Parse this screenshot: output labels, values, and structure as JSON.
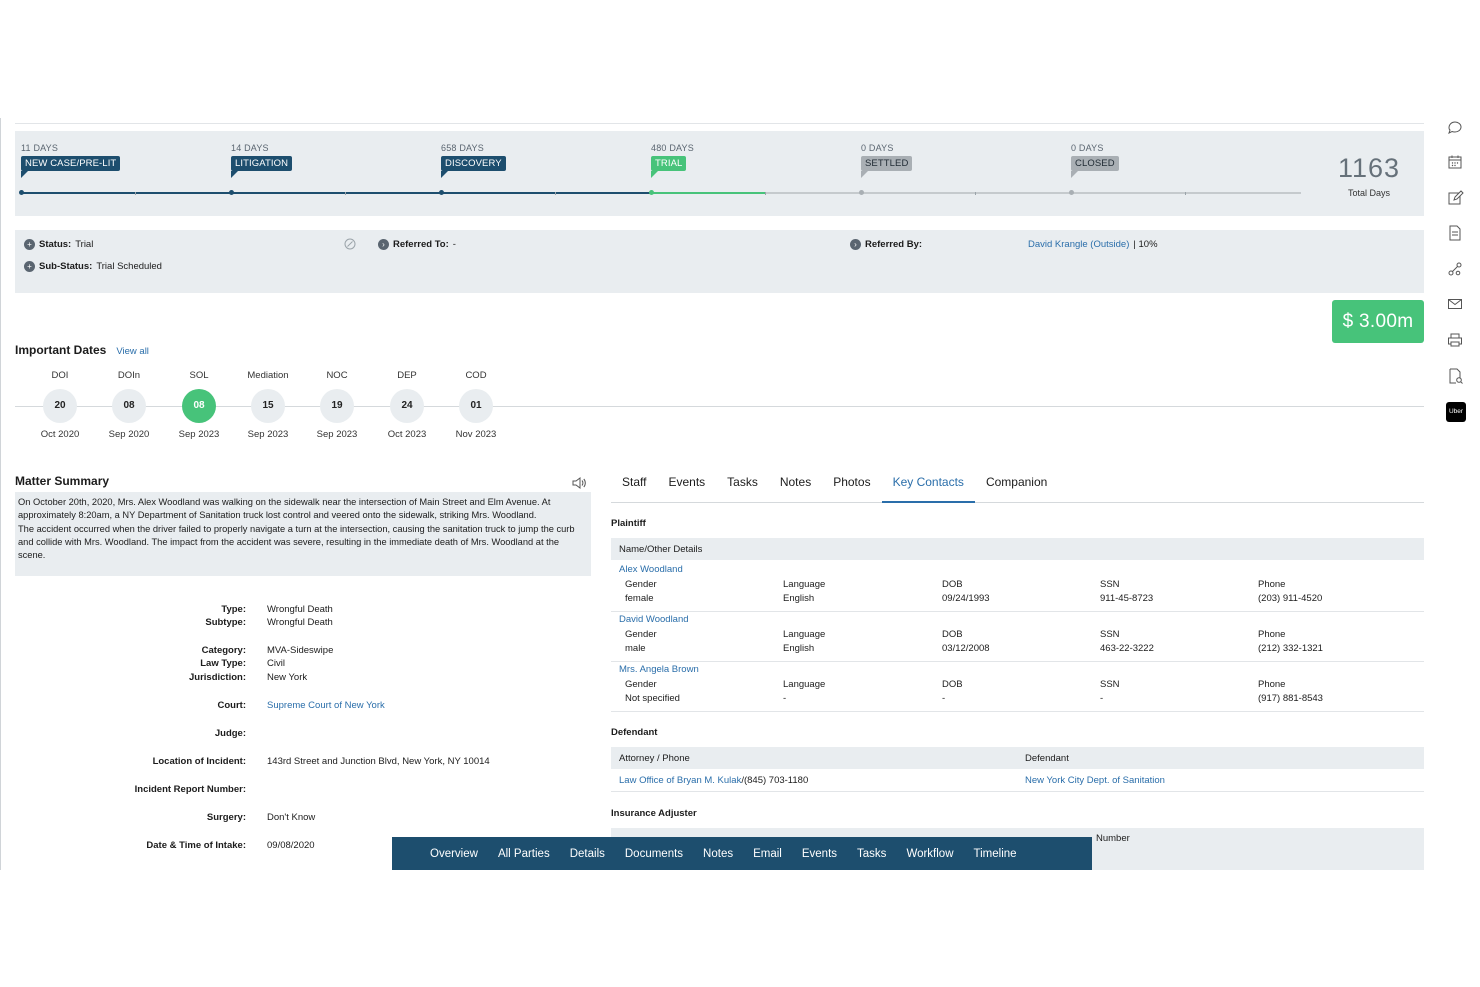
{
  "stages": [
    {
      "days": "11 DAYS",
      "label": "NEW CASE/PRE-LIT",
      "state": "past"
    },
    {
      "days": "14 DAYS",
      "label": "LITIGATION",
      "state": "past"
    },
    {
      "days": "658 DAYS",
      "label": "DISCOVERY",
      "state": "past"
    },
    {
      "days": "480 DAYS",
      "label": "TRIAL",
      "state": "current"
    },
    {
      "days": "0 DAYS",
      "label": "SETTLED",
      "state": "future"
    },
    {
      "days": "0 DAYS",
      "label": "CLOSED",
      "state": "future"
    }
  ],
  "total": {
    "value": "1163",
    "label": "Total Days"
  },
  "status": {
    "status_label": "Status:",
    "status_value": "Trial",
    "substatus_label": "Sub-Status:",
    "substatus_value": "Trial Scheduled",
    "referred_to_label": "Referred To:",
    "referred_to_value": "-",
    "referred_by_label": "Referred By:",
    "referred_by_value": "David Krangle (Outside)",
    "referred_by_pct": "| 10%"
  },
  "case_value": "$ 3.00m",
  "important_dates": {
    "title": "Important Dates",
    "view_all": "View all",
    "items": [
      {
        "abbr": "DOI",
        "day": "20",
        "month_year": "Oct 2020",
        "active": false
      },
      {
        "abbr": "DOIn",
        "day": "08",
        "month_year": "Sep 2020",
        "active": false
      },
      {
        "abbr": "SOL",
        "day": "08",
        "month_year": "Sep 2023",
        "active": true
      },
      {
        "abbr": "Mediation",
        "day": "15",
        "month_year": "Sep 2023",
        "active": false
      },
      {
        "abbr": "NOC",
        "day": "19",
        "month_year": "Sep 2023",
        "active": false
      },
      {
        "abbr": "DEP",
        "day": "24",
        "month_year": "Oct 2023",
        "active": false
      },
      {
        "abbr": "COD",
        "day": "01",
        "month_year": "Nov 2023",
        "active": false
      }
    ]
  },
  "matter_summary": {
    "title": "Matter Summary",
    "p1": "On October 20th, 2020, Mrs. Alex Woodland was walking on the sidewalk near the intersection of Main Street and Elm Avenue. At approximately 8:20am, a NY Department of Sanitation truck lost control and veered onto the sidewalk, striking Mrs. Woodland.",
    "p2": "The accident occurred when the driver failed to properly navigate a turn at the intersection, causing the sanitation truck to jump the curb and collide with Mrs. Woodland. The impact from the accident was severe, resulting in the immediate death of Mrs. Woodland at the scene.",
    "facts": [
      {
        "k": "Type:",
        "v": "Wrongful Death"
      },
      {
        "k": "Subtype:",
        "v": "Wrongful Death"
      },
      {
        "k": "Category:",
        "v": "MVA-Sideswipe"
      },
      {
        "k": "Law Type:",
        "v": "Civil"
      },
      {
        "k": "Jurisdiction:",
        "v": "New York"
      },
      {
        "k": "Court:",
        "v": "Supreme Court of New York"
      },
      {
        "k": "Judge:",
        "v": ""
      },
      {
        "k": "Location of Incident:",
        "v": "143rd Street and Junction Blvd, New York, NY 10014"
      },
      {
        "k": "Incident Report Number:",
        "v": ""
      },
      {
        "k": "Surgery:",
        "v": "Don't Know"
      },
      {
        "k": "Date & Time of Intake:",
        "v": "09/08/2020"
      }
    ]
  },
  "tabs": [
    "Staff",
    "Events",
    "Tasks",
    "Notes",
    "Photos",
    "Key Contacts",
    "Companion"
  ],
  "active_tab": "Key Contacts",
  "plaintiff": {
    "section": "Plaintiff",
    "header": "Name/Other Details",
    "labels": {
      "gender": "Gender",
      "language": "Language",
      "dob": "DOB",
      "ssn": "SSN",
      "phone": "Phone"
    },
    "rows": [
      {
        "name": "Alex Woodland",
        "gender": "female",
        "language": "English",
        "dob": "09/24/1993",
        "ssn": "911-45-8723",
        "phone": "(203) 911-4520"
      },
      {
        "name": "David Woodland",
        "gender": "male",
        "language": "English",
        "dob": "03/12/2008",
        "ssn": "463-22-3222",
        "phone": "(212) 332-1321"
      },
      {
        "name": "Mrs. Angela Brown",
        "gender": "Not specified",
        "language": "-",
        "dob": "-",
        "ssn": "-",
        "phone": "(917) 881-8543"
      }
    ]
  },
  "defendant": {
    "section": "Defendant",
    "col1": "Attorney / Phone",
    "col2": "Defendant",
    "attorney": "Law Office of Bryan M. Kulak",
    "attorney_phone": "/(845) 703-1180",
    "defendant": "New York City Dept. of Sanitation"
  },
  "insurance": {
    "section": "Insurance Adjuster",
    "partial_header": "Number"
  },
  "bottom_nav": [
    "Overview",
    "All Parties",
    "Details",
    "Documents",
    "Notes",
    "Email",
    "Events",
    "Tasks",
    "Workflow",
    "Timeline"
  ],
  "rail_icons": [
    "chat-icon",
    "calendar-icon",
    "edit-icon",
    "document-icon",
    "workflow-icon",
    "mail-icon",
    "print-icon",
    "file-search-icon",
    "uber-icon"
  ],
  "uber_label": "Uber",
  "colors": {
    "navy": "#1d4e6e",
    "green": "#47c37a",
    "link": "#2a6eaa",
    "panel": "#e9edf0"
  }
}
